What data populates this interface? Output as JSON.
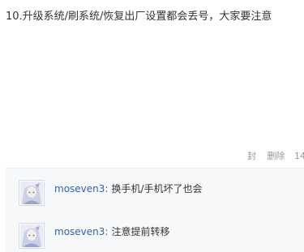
{
  "post": {
    "text": "10.升级系统/刷系统/恢复出厂设置都会丢号，大家要注意"
  },
  "actions": {
    "block_label": "封",
    "delete_label": "删除",
    "time": "14"
  },
  "comments": [
    {
      "user": "moseven3",
      "separator": ":",
      "text": "换手机/手机坏了也会",
      "avatar": "anime-character-avatar"
    },
    {
      "user": "moseven3",
      "separator": ":",
      "text": "注意提前转移",
      "avatar": "anime-character-avatar"
    }
  ],
  "colors": {
    "username": "#2d64b3",
    "comment_bg": "#f7f8fa",
    "muted": "#999999"
  }
}
